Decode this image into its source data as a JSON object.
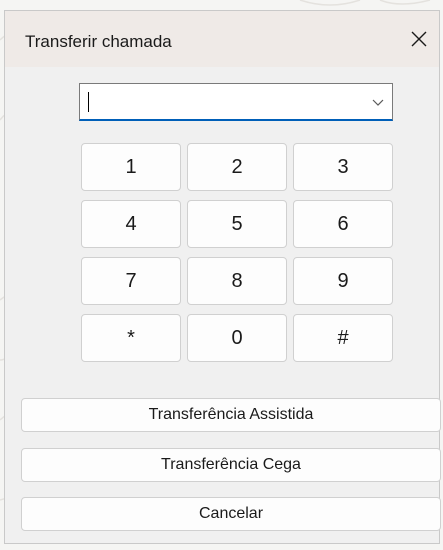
{
  "dialog": {
    "title": "Transferir chamada",
    "close_icon": "close-icon"
  },
  "number_field": {
    "value": "",
    "dropdown_icon": "chevron-down-icon"
  },
  "keypad": {
    "keys": [
      "1",
      "2",
      "3",
      "4",
      "5",
      "6",
      "7",
      "8",
      "9",
      "*",
      "0",
      "#"
    ]
  },
  "actions": {
    "assisted_transfer": "Transferência Assistida",
    "blind_transfer": "Transferência Cega",
    "cancel": "Cancelar"
  },
  "colors": {
    "focus_accent": "#005fb8",
    "titlebar_bg": "#efeae7",
    "dialog_bg": "#f0f0f0"
  }
}
